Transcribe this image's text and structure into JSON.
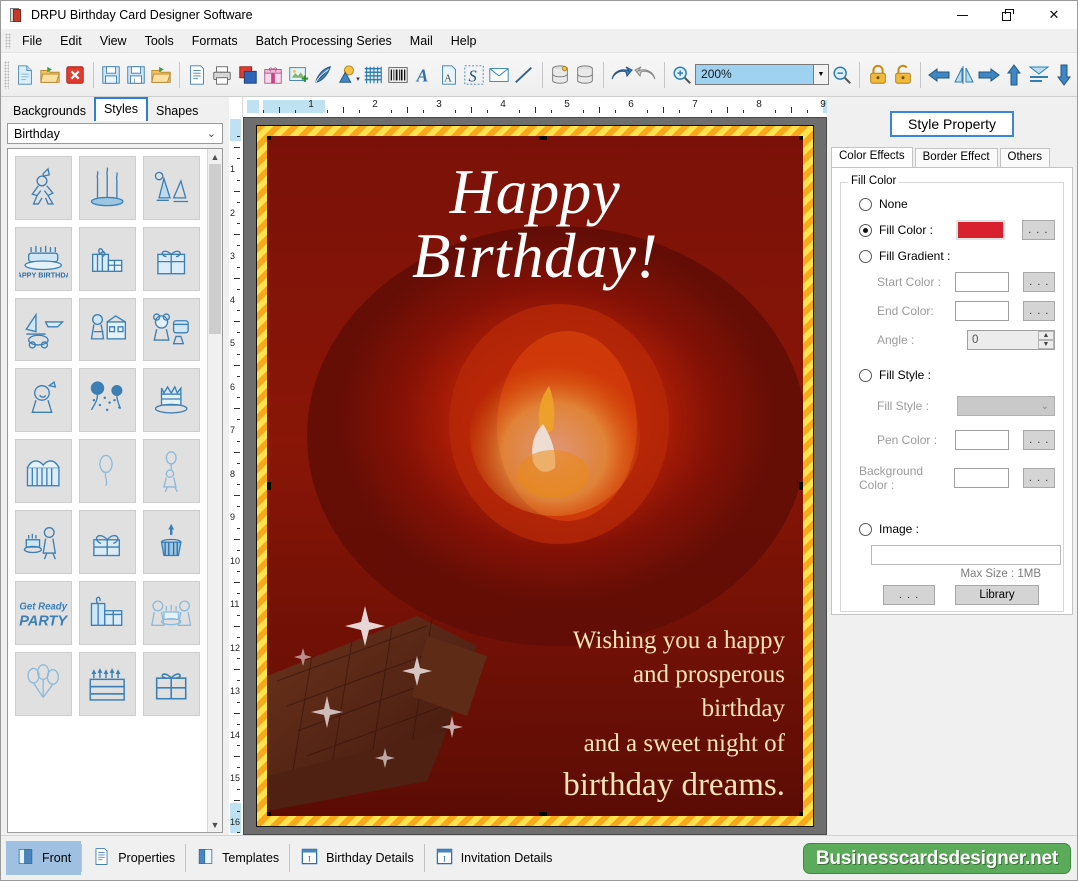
{
  "window": {
    "title": "DRPU Birthday Card Designer Software",
    "controls": {
      "minimize": "minimize-button",
      "maximize": "restore-button",
      "close": "close-button"
    }
  },
  "menubar": {
    "items": [
      "File",
      "Edit",
      "View",
      "Tools",
      "Formats",
      "Batch Processing Series",
      "Mail",
      "Help"
    ]
  },
  "toolbar": {
    "zoom_value": "200%",
    "icons": [
      "new-document-icon",
      "open-folder-icon",
      "close-document-icon",
      "save-icon",
      "save-as-icon",
      "export-folder-icon",
      "page-setup-icon",
      "print-icon",
      "cards-icon",
      "gift-icon",
      "insert-image-icon",
      "pen-icon",
      "shapes-icon",
      "watermark-icon",
      "barcode-icon",
      "text-icon",
      "text-box-icon",
      "signature-icon",
      "envelope-icon",
      "line-icon",
      "database-add-icon",
      "database-icon",
      "undo-icon",
      "redo-icon",
      "zoom-in-icon",
      "zoom-out-icon",
      "lock-icon",
      "unlock-icon",
      "align-left-icon",
      "flip-horizontal-icon",
      "align-right-icon",
      "align-top-icon",
      "align-center-icon",
      "align-bottom-icon"
    ]
  },
  "left_panel": {
    "tabs": [
      {
        "label": "Backgrounds",
        "active": false
      },
      {
        "label": "Styles",
        "active": true
      },
      {
        "label": "Shapes",
        "active": false
      }
    ],
    "category": "Birthday",
    "thumbnails": [
      "clown-clipart",
      "birthday-candles-clipart",
      "party-hats-clipart",
      "happy-birthday-cake-clipart",
      "gift-boxes-clipart",
      "wrapped-gift-clipart",
      "toys-boat-plane-clipart",
      "girl-dollhouse-clipart",
      "teddy-toys-clipart",
      "baby-clipart",
      "balloons-confetti-clipart",
      "cake-crown-clipart",
      "striped-gift-box-clipart",
      "balloon-clipart",
      "child-balloon-clipart",
      "cake-children-clipart",
      "gift-ribbon-clipart",
      "cupcake-candle-clipart",
      "get-ready-to-party-clipart",
      "stacked-gifts-clipart",
      "kids-cake-clipart",
      "three-balloons-clipart",
      "tiered-cake-clipart",
      "gift-box-outline-clipart"
    ]
  },
  "rulers": {
    "horizontal_labels": [
      "1",
      "2",
      "3",
      "4",
      "5",
      "6",
      "7",
      "8",
      "9"
    ],
    "vertical_labels": [
      "1",
      "2",
      "3",
      "4",
      "5",
      "6",
      "7",
      "8",
      "9",
      "10",
      "11",
      "12",
      "13",
      "14",
      "15",
      "16"
    ]
  },
  "card": {
    "heading_line1": "Happy",
    "heading_line2": "Birthday!",
    "message_lines": [
      "Wishing you a happy",
      "and prosperous",
      "birthday",
      "and a sweet night of"
    ],
    "message_last_line": "birthday dreams.",
    "background_color": "#6b0d06",
    "border_colors": [
      "#f7a81b",
      "#ffe24d"
    ],
    "heading_color": "#ffffff",
    "message_color": "#f6e3b8"
  },
  "right_panel": {
    "title": "Style Property",
    "tabs": [
      {
        "label": "Color Effects",
        "active": true
      },
      {
        "label": "Border Effect",
        "active": false
      },
      {
        "label": "Others",
        "active": false
      }
    ],
    "group_label": "Fill Color",
    "options": {
      "none": "None",
      "fill_color": "Fill Color :",
      "fill_gradient": "Fill Gradient :",
      "fill_style": "Fill Style :",
      "image": "Image :"
    },
    "selected_option": "fill_color",
    "fill_color_swatch": "#d8202f",
    "fields": {
      "start_color": "Start Color :",
      "end_color": "End Color:",
      "angle": "Angle :",
      "angle_value": "0",
      "fill_style": "Fill Style :",
      "pen_color": "Pen Color :",
      "background_color": "Background Color :"
    },
    "image_path": "",
    "max_size": "Max Size : 1MB",
    "buttons": {
      "browse": ". . .",
      "library": "Library"
    }
  },
  "statusbar": {
    "items": [
      {
        "label": "Front",
        "icon": "card-front-icon",
        "active": true
      },
      {
        "label": "Properties",
        "icon": "properties-icon",
        "active": false
      },
      {
        "label": "Templates",
        "icon": "templates-icon",
        "active": false
      },
      {
        "label": "Birthday Details",
        "icon": "birthday-details-icon",
        "active": false
      },
      {
        "label": "Invitation Details",
        "icon": "invitation-details-icon",
        "active": false
      }
    ],
    "brand": "Businesscardsdesigner.net",
    "brand_color": "#5cab5a"
  }
}
